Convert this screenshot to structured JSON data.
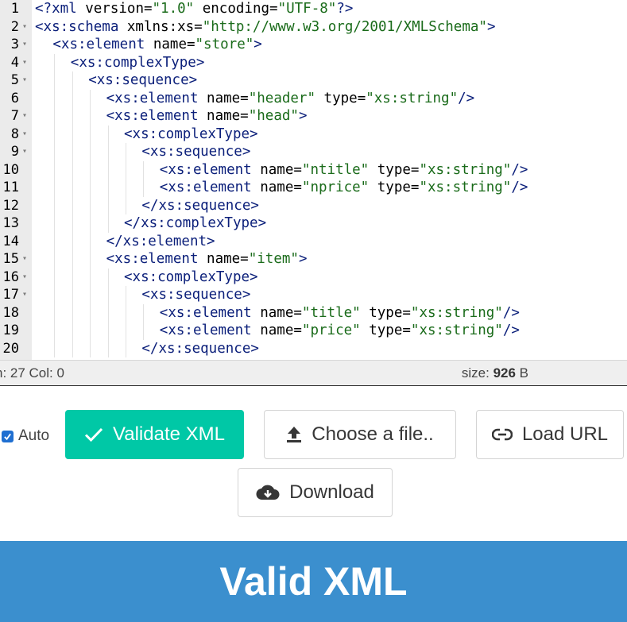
{
  "editor": {
    "lines": [
      {
        "n": "1",
        "fold": false,
        "indent": 0,
        "tokens": [
          [
            "pi",
            "<?xml"
          ],
          [
            "plain",
            " version="
          ],
          [
            "str",
            "\"1.0\""
          ],
          [
            "plain",
            " encoding="
          ],
          [
            "str",
            "\"UTF-8\""
          ],
          [
            "pi",
            "?>"
          ]
        ]
      },
      {
        "n": "2",
        "fold": true,
        "indent": 0,
        "tokens": [
          [
            "tag",
            "<xs:schema"
          ],
          [
            "plain",
            " xmlns:xs="
          ],
          [
            "str",
            "\"http://www.w3.org/2001/XMLSchema\""
          ],
          [
            "tag",
            ">"
          ]
        ]
      },
      {
        "n": "3",
        "fold": true,
        "indent": 1,
        "tokens": [
          [
            "tag",
            "<xs:element"
          ],
          [
            "plain",
            " name="
          ],
          [
            "str",
            "\"store\""
          ],
          [
            "tag",
            ">"
          ]
        ]
      },
      {
        "n": "4",
        "fold": true,
        "indent": 2,
        "tokens": [
          [
            "tag",
            "<xs:complexType>"
          ]
        ]
      },
      {
        "n": "5",
        "fold": true,
        "indent": 3,
        "tokens": [
          [
            "tag",
            "<xs:sequence>"
          ]
        ]
      },
      {
        "n": "6",
        "fold": false,
        "indent": 4,
        "tokens": [
          [
            "tag",
            "<xs:element"
          ],
          [
            "plain",
            " name="
          ],
          [
            "str",
            "\"header\""
          ],
          [
            "plain",
            " type="
          ],
          [
            "str",
            "\"xs:string\""
          ],
          [
            "tag",
            "/>"
          ]
        ]
      },
      {
        "n": "7",
        "fold": true,
        "indent": 4,
        "tokens": [
          [
            "tag",
            "<xs:element"
          ],
          [
            "plain",
            " name="
          ],
          [
            "str",
            "\"head\""
          ],
          [
            "tag",
            ">"
          ]
        ]
      },
      {
        "n": "8",
        "fold": true,
        "indent": 5,
        "tokens": [
          [
            "tag",
            "<xs:complexType>"
          ]
        ]
      },
      {
        "n": "9",
        "fold": true,
        "indent": 6,
        "tokens": [
          [
            "tag",
            "<xs:sequence>"
          ]
        ]
      },
      {
        "n": "10",
        "fold": false,
        "indent": 7,
        "tokens": [
          [
            "tag",
            "<xs:element"
          ],
          [
            "plain",
            " name="
          ],
          [
            "str",
            "\"ntitle\""
          ],
          [
            "plain",
            " type="
          ],
          [
            "str",
            "\"xs:string\""
          ],
          [
            "tag",
            "/>"
          ]
        ]
      },
      {
        "n": "11",
        "fold": false,
        "indent": 7,
        "tokens": [
          [
            "tag",
            "<xs:element"
          ],
          [
            "plain",
            " name="
          ],
          [
            "str",
            "\"nprice\""
          ],
          [
            "plain",
            " type="
          ],
          [
            "str",
            "\"xs:string\""
          ],
          [
            "tag",
            "/>"
          ]
        ]
      },
      {
        "n": "12",
        "fold": false,
        "indent": 6,
        "tokens": [
          [
            "tag",
            "</xs:sequence>"
          ]
        ]
      },
      {
        "n": "13",
        "fold": false,
        "indent": 5,
        "tokens": [
          [
            "tag",
            "</xs:complexType>"
          ]
        ]
      },
      {
        "n": "14",
        "fold": false,
        "indent": 4,
        "tokens": [
          [
            "tag",
            "</xs:element>"
          ]
        ]
      },
      {
        "n": "15",
        "fold": true,
        "indent": 4,
        "tokens": [
          [
            "tag",
            "<xs:element"
          ],
          [
            "plain",
            " name="
          ],
          [
            "str",
            "\"item\""
          ],
          [
            "tag",
            ">"
          ]
        ]
      },
      {
        "n": "16",
        "fold": true,
        "indent": 5,
        "tokens": [
          [
            "tag",
            "<xs:complexType>"
          ]
        ]
      },
      {
        "n": "17",
        "fold": true,
        "indent": 6,
        "tokens": [
          [
            "tag",
            "<xs:sequence>"
          ]
        ]
      },
      {
        "n": "18",
        "fold": false,
        "indent": 7,
        "tokens": [
          [
            "tag",
            "<xs:element"
          ],
          [
            "plain",
            " name="
          ],
          [
            "str",
            "\"title\""
          ],
          [
            "plain",
            " type="
          ],
          [
            "str",
            "\"xs:string\""
          ],
          [
            "tag",
            "/>"
          ]
        ]
      },
      {
        "n": "19",
        "fold": false,
        "indent": 7,
        "tokens": [
          [
            "tag",
            "<xs:element"
          ],
          [
            "plain",
            " name="
          ],
          [
            "str",
            "\"price\""
          ],
          [
            "plain",
            " type="
          ],
          [
            "str",
            "\"xs:string\""
          ],
          [
            "tag",
            "/>"
          ]
        ]
      },
      {
        "n": "20",
        "fold": false,
        "indent": 6,
        "tokens": [
          [
            "tag",
            "</xs:sequence>"
          ]
        ]
      }
    ]
  },
  "status": {
    "position": "n: 27 Col: 0",
    "size_label": "size: ",
    "size_value": "926",
    "size_unit": " B"
  },
  "toolbar": {
    "auto_label": "Auto",
    "auto_checked": true,
    "validate_label": "Validate XML",
    "choose_label": "Choose a file..",
    "loadurl_label": "Load URL",
    "download_label": "Download"
  },
  "result": {
    "message": "Valid XML",
    "color": "#3b8fce"
  },
  "icons": {
    "validate": "check-icon",
    "choose": "upload-icon",
    "loadurl": "link-icon",
    "download": "cloud-download-icon"
  }
}
